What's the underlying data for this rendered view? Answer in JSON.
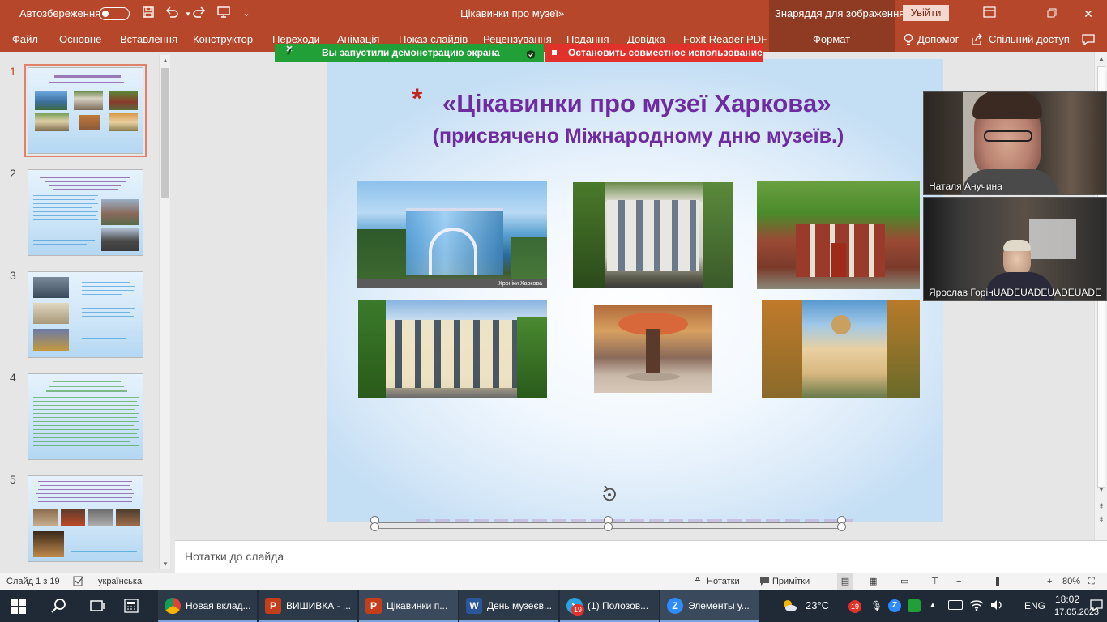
{
  "titlebar": {
    "autosave_label": "Автозбереження",
    "document_title": "Цікавинки про музеї»",
    "contextual_header": "Знаряддя для зображення",
    "sign_in": "Увійти",
    "icons": [
      "save-icon",
      "undo-icon",
      "redo-icon",
      "present-icon",
      "customize-icon",
      "ribbon-display-icon",
      "minimize-icon",
      "maximize-icon",
      "close-icon"
    ]
  },
  "ribbon": {
    "tabs": [
      "Файл",
      "Основне",
      "Вставлення",
      "Конструктор",
      "Переходи",
      "Анімація",
      "Показ слайдів",
      "Рецензування",
      "Подання",
      "Довідка",
      "Foxit Reader PDF",
      "Формат"
    ],
    "help_label": "Допомог",
    "share_label": "Спільний доступ",
    "icons": [
      "lightbulb-icon",
      "share-icon",
      "comments-icon"
    ]
  },
  "share_indicator": {
    "sharing_text": "Вы запустили демонстрацию экрана",
    "stop_text": "Остановить совместное использование",
    "green": "#21a038",
    "red": "#e0312b"
  },
  "slides": [
    {
      "number": "1",
      "title": "«Цікавинки про музеї Харкова» (присвячено Міжнародному дню музеїв.)",
      "selected": true
    },
    {
      "number": "2"
    },
    {
      "number": "3"
    },
    {
      "number": "4"
    },
    {
      "number": "5"
    }
  ],
  "slide": {
    "title_line1": "«Цікавинки про музеї Харкова»",
    "title_line2": "(присвячено Міжнародному дню музеїв.)",
    "bullet": "*",
    "photo1_caption": "Хроніки Харкова",
    "title_color": "#6f2ca0"
  },
  "webcams": [
    {
      "name": "Наталя Анучина"
    },
    {
      "name": "Ярослав ГорінUADEUADEUADEUADE"
    }
  ],
  "notes": {
    "placeholder": "Нотатки до слайда"
  },
  "status": {
    "slide_counter": "Слайд 1 з 19",
    "language": "українська",
    "notes_label": "Нотатки",
    "comments_label": "Примітки",
    "zoom": "80%",
    "zoom_fraction": 0.4
  },
  "taskbar": {
    "apps": [
      {
        "label": "Новая вклад...",
        "icon": "chrome-icon"
      },
      {
        "label": "ВИШИВКА - ...",
        "icon": "powerpoint-icon"
      },
      {
        "label": "Цікавинки п...",
        "icon": "powerpoint-icon"
      },
      {
        "label": "День музеєв...",
        "icon": "word-icon"
      },
      {
        "label": "(1) Полозов...",
        "icon": "telegram-icon",
        "badge": "19"
      },
      {
        "label": "Элементы у...",
        "icon": "zoom-icon"
      }
    ],
    "weather": "23°C",
    "language": "ENG",
    "time": "18:02",
    "date": "17.05.2023",
    "tray_badge": "19"
  }
}
